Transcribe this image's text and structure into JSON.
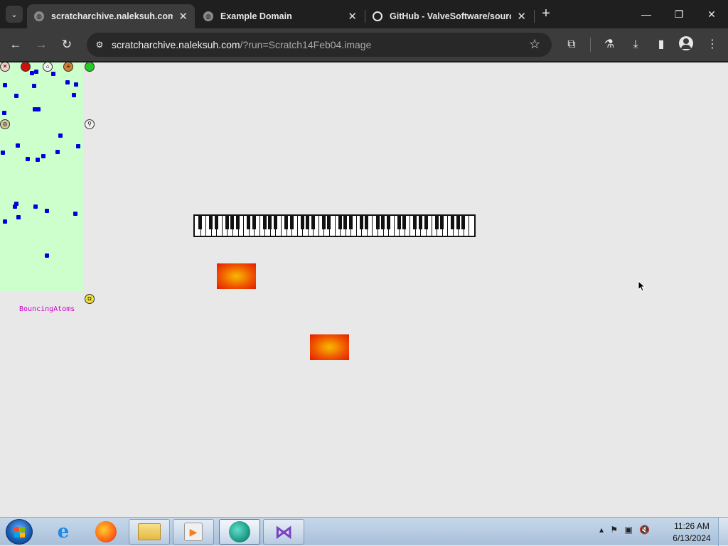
{
  "browser": {
    "tabs": [
      {
        "title": "scratcharchive.naleksuh.com/?",
        "active": true,
        "favicon": "globe-icon"
      },
      {
        "title": "Example Domain",
        "active": false,
        "favicon": "globe-icon"
      },
      {
        "title": "GitHub - ValveSoftware/source",
        "active": false,
        "favicon": "github-icon"
      }
    ],
    "url_host": "scratcharchive.naleksuh.com",
    "url_path": "/?run=Scratch14Feb04.image",
    "window_controls": {
      "minimize": "—",
      "restore": "❐",
      "close": "✕"
    }
  },
  "page": {
    "stage_label": "BouncingAtoms",
    "stage_color": "#ccffcc",
    "atom_color": "#0000dd"
  },
  "taskbar": {
    "apps": [
      "Internet Explorer",
      "Firefox",
      "File Explorer",
      "Media Player",
      "Browser",
      "Visual Studio"
    ],
    "clock_time": "11:26 AM",
    "clock_date": "6/13/2024"
  }
}
